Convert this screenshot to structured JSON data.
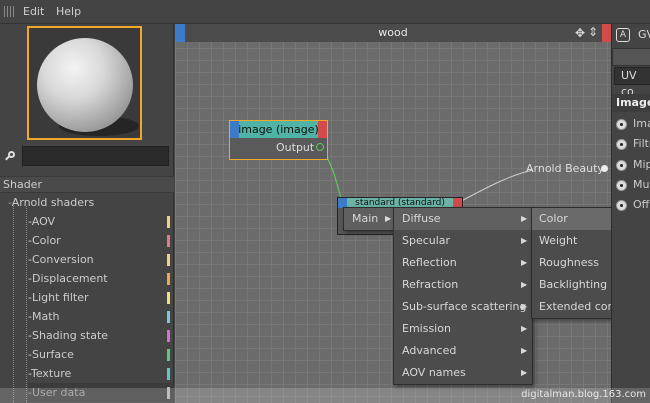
{
  "menubar": {
    "edit": "Edit",
    "help": "Help"
  },
  "left_panel": {
    "shader_header": "Shader",
    "tree_root": "Arnold shaders",
    "items": [
      {
        "label": "AOV",
        "color": "#f0d27a"
      },
      {
        "label": "Color",
        "color": "#e07a8a"
      },
      {
        "label": "Conversion",
        "color": "#f0d27a"
      },
      {
        "label": "Displacement",
        "color": "#f0a84a"
      },
      {
        "label": "Light filter",
        "color": "#f0e07a"
      },
      {
        "label": "Math",
        "color": "#7ac8e0"
      },
      {
        "label": "Shading state",
        "color": "#d070d0"
      },
      {
        "label": "Surface",
        "color": "#5ec88a"
      },
      {
        "label": "Texture",
        "color": "#5ec8c8"
      },
      {
        "label": "User data",
        "color": "#b0b0b0"
      }
    ]
  },
  "editor": {
    "title": "wood",
    "image_node": {
      "title": "image (image)",
      "port": "Output"
    },
    "standard_node": {
      "title": "standard (standard)"
    },
    "arnold_beauty": "Arnold Beauty"
  },
  "context_menu": {
    "main": "Main",
    "level1": [
      "Diffuse",
      "Specular",
      "Reflection",
      "Refraction",
      "Sub-surface scattering",
      "Emission",
      "Advanced",
      "AOV names"
    ],
    "level2": [
      "Color",
      "Weight",
      "Roughness",
      "Backlighting",
      "Extended controls"
    ]
  },
  "right_panel": {
    "top_label": "GV",
    "uv_label": "UV co",
    "section": "Image",
    "options": [
      "Ima",
      "Filte",
      "Mip",
      "Mu",
      "Off"
    ]
  },
  "watermark": "digitalman.blog.163.com"
}
